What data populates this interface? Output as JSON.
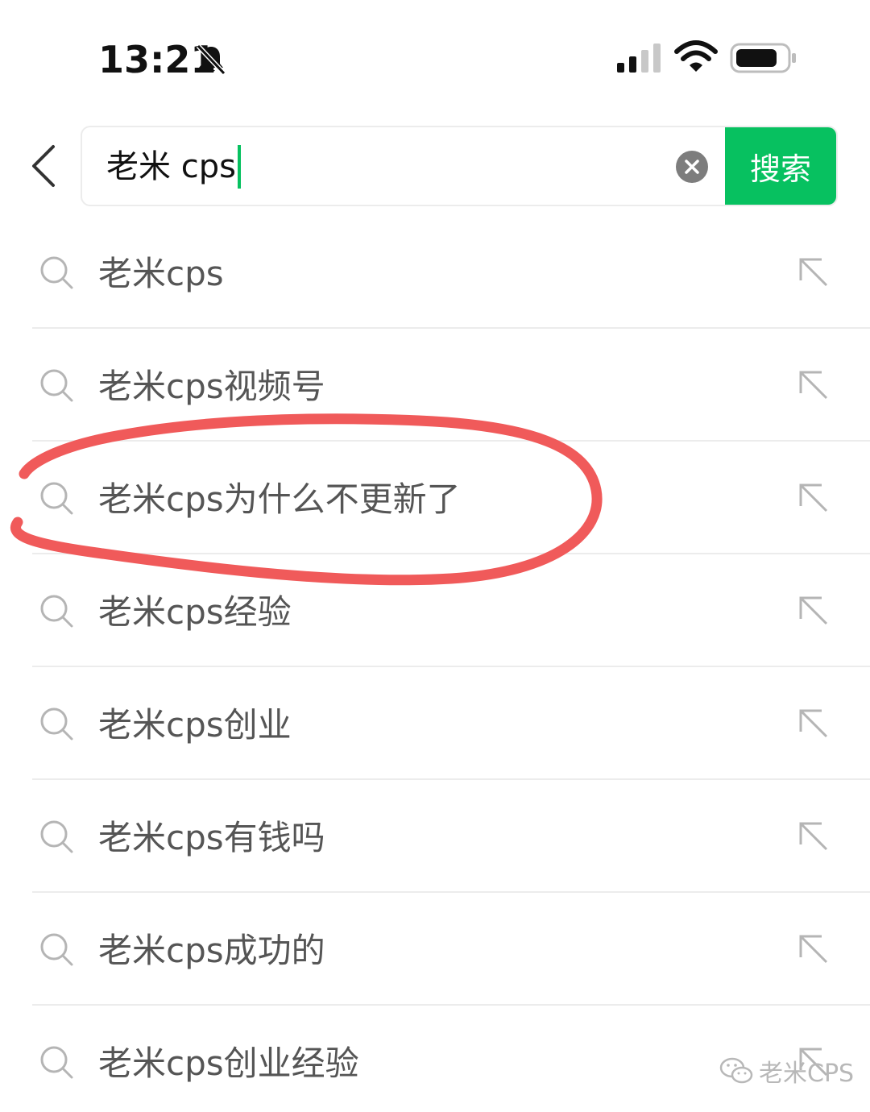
{
  "status_bar": {
    "time": "13:21",
    "icons": [
      "bell-muted-icon",
      "signal-icon",
      "wifi-icon",
      "battery-icon"
    ]
  },
  "search": {
    "query": "老米 cps",
    "button_label": "搜索",
    "clear_icon": "clear-icon",
    "back_icon": "back-chevron-icon"
  },
  "suggestions": [
    {
      "label": "老米cps"
    },
    {
      "label": "老米cps视频号"
    },
    {
      "label": "老米cps为什么不更新了"
    },
    {
      "label": "老米cps经验"
    },
    {
      "label": "老米cps创业"
    },
    {
      "label": "老米cps有钱吗"
    },
    {
      "label": "老米cps成功的"
    },
    {
      "label": "老米cps创业经验"
    }
  ],
  "annotation": {
    "color": "#f05a5a"
  },
  "watermark": {
    "text": "老米CPS"
  },
  "colors": {
    "accent": "#07c160",
    "text_secondary": "#555555",
    "divider": "#ececec"
  }
}
